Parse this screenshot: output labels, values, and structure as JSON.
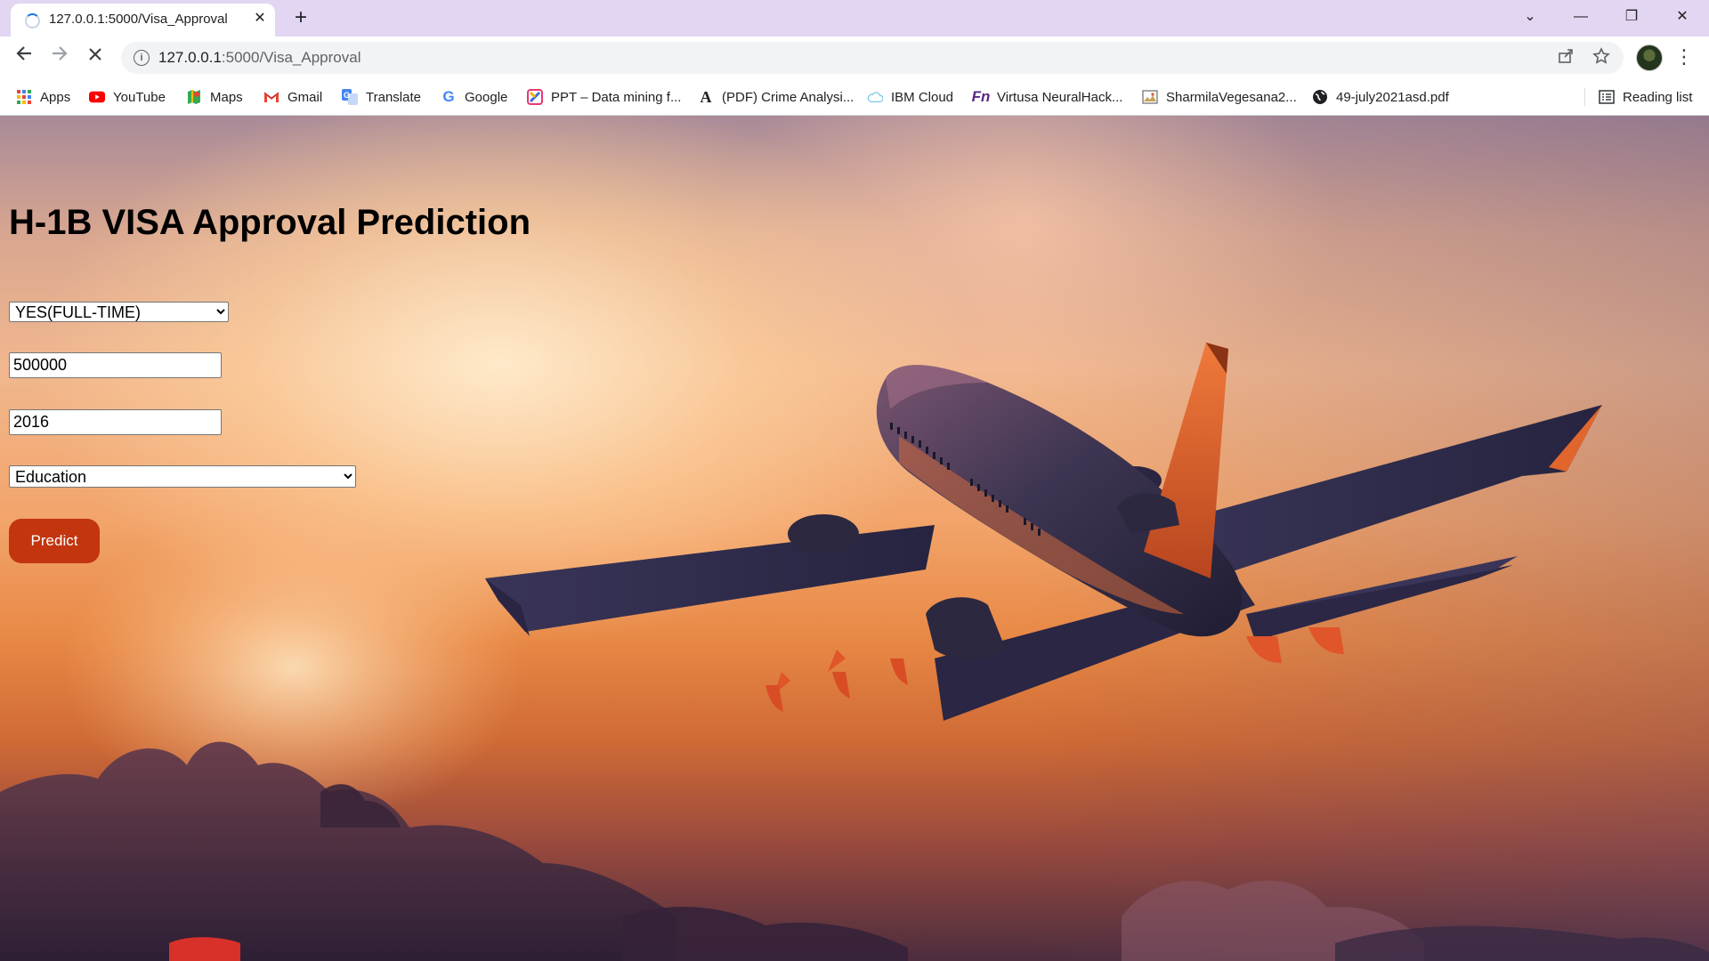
{
  "browser": {
    "tab_title": "127.0.0.1:5000/Visa_Approval",
    "tab_close_glyph": "✕",
    "new_tab_glyph": "+",
    "url_host": "127.0.0.1",
    "url_path": ":5000/Visa_Approval",
    "window_buttons": {
      "tab_search": "⌄",
      "minimize": "—",
      "restore": "❐",
      "close": "✕"
    }
  },
  "bookmarks": [
    {
      "label": "Apps",
      "icon": "apps-grid-icon"
    },
    {
      "label": "YouTube",
      "icon": "youtube-icon"
    },
    {
      "label": "Maps",
      "icon": "maps-icon"
    },
    {
      "label": "Gmail",
      "icon": "gmail-icon"
    },
    {
      "label": "Translate",
      "icon": "translate-icon"
    },
    {
      "label": "Google",
      "icon": "google-icon"
    },
    {
      "label": "PPT – Data mining f...",
      "icon": "ppt-icon"
    },
    {
      "label": "(PDF) Crime Analysi...",
      "icon": "academia-icon"
    },
    {
      "label": "IBM Cloud",
      "icon": "cloud-icon"
    },
    {
      "label": "Virtusa NeuralHack...",
      "icon": "virtusa-icon"
    },
    {
      "label": "SharmilaVegesana2...",
      "icon": "image-icon"
    },
    {
      "label": "49-july2021asd.pdf",
      "icon": "globe-icon"
    }
  ],
  "reading_list": {
    "label": "Reading list",
    "icon": "reading-list-icon"
  },
  "page": {
    "title": "H-1B VISA Approval Prediction",
    "full_time_select": {
      "selected": "YES(FULL-TIME)"
    },
    "wage_input": {
      "value": "500000"
    },
    "year_input": {
      "value": "2016"
    },
    "category_select": {
      "selected": "Education"
    },
    "predict_button": {
      "label": "Predict"
    }
  },
  "colors": {
    "tabstrip": "#e2d6f3",
    "predict_button": "#c2350f"
  }
}
